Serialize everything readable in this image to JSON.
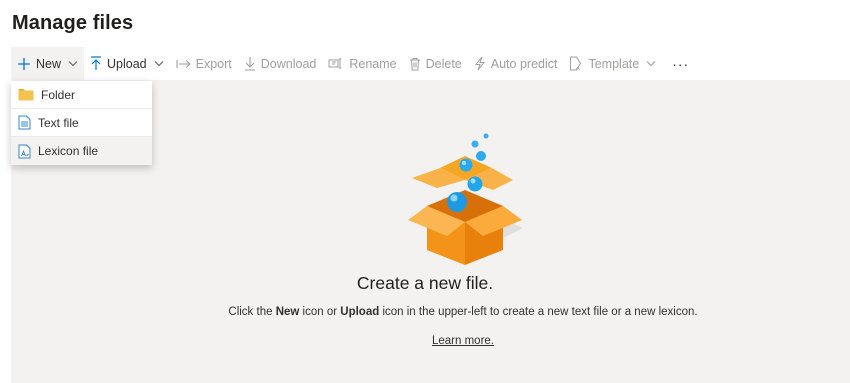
{
  "page": {
    "title": "Manage files"
  },
  "toolbar": {
    "new_label": "New",
    "upload_label": "Upload",
    "export_label": "Export",
    "download_label": "Download",
    "rename_label": "Rename",
    "delete_label": "Delete",
    "auto_predict_label": "Auto predict",
    "template_label": "Template",
    "more_label": "···"
  },
  "new_menu": {
    "items": [
      {
        "label": "Folder",
        "icon": "folder-icon"
      },
      {
        "label": "Text file",
        "icon": "text-file-icon"
      },
      {
        "label": "Lexicon file",
        "icon": "lexicon-file-icon"
      }
    ]
  },
  "empty_state": {
    "title": "Create a new file.",
    "desc_part1": "Click the ",
    "desc_new": "New",
    "desc_part2": " icon or ",
    "desc_upload": "Upload",
    "desc_part3": " icon in the upper-left to create a new text file or a new lexicon.",
    "learn_more": "Learn more."
  },
  "colors": {
    "accent": "#0078d4",
    "canvas_bg": "#f3f2f1",
    "disabled_text": "#a19f9d",
    "box_orange": "#f7931e",
    "bubble_blue": "#1e9be0"
  }
}
